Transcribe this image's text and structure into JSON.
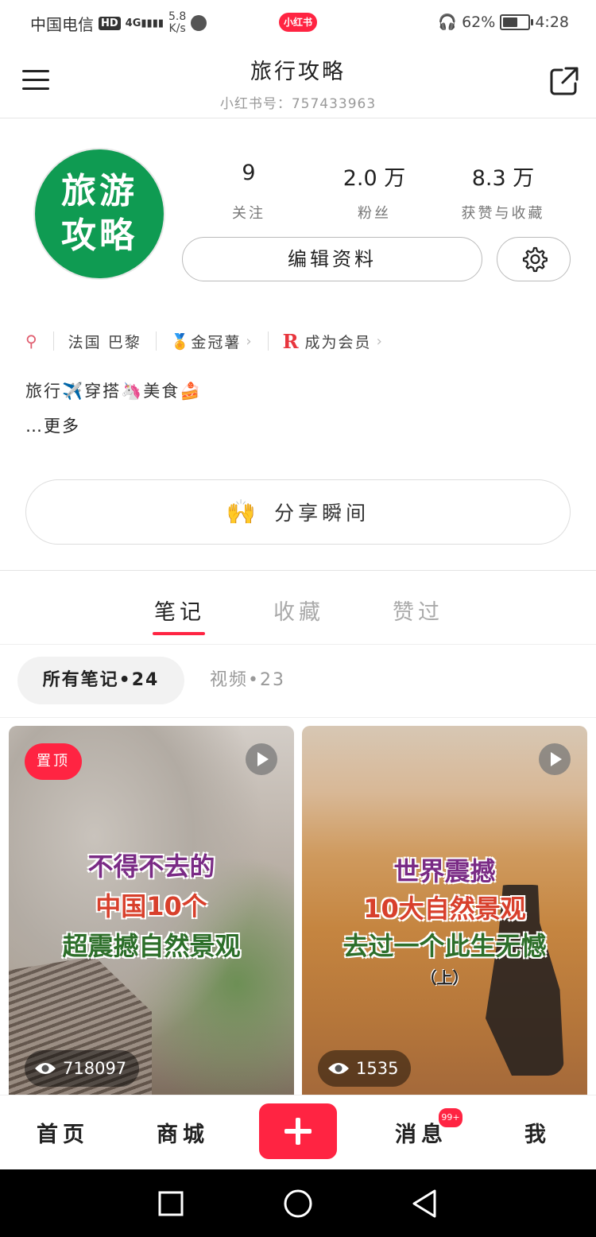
{
  "status_bar": {
    "carrier": "中国电信",
    "hd": "HD",
    "signal": "4G",
    "speed_value": "5.8",
    "speed_unit": "K/s",
    "app_pill": "小红书",
    "battery": "62%",
    "battery_level": 0.62,
    "time": "4:28"
  },
  "header": {
    "title": "旅行攻略",
    "account_id": "小红书号：757433963"
  },
  "profile": {
    "avatar_line1": "旅游",
    "avatar_line2": "攻略",
    "avatar_color": "#0f9b52",
    "stats": [
      {
        "value": "9",
        "label": "关注"
      },
      {
        "value": "2.0 万",
        "label": "粉丝"
      },
      {
        "value": "8.3 万",
        "label": "获赞与收藏"
      }
    ],
    "edit_button": "编辑资料",
    "tags": {
      "location": "法国 巴黎",
      "crown": "金冠薯",
      "member": "成为会员"
    },
    "bio": "旅行✈️穿搭🦄美食🍰",
    "more": "…更多"
  },
  "moment_button": {
    "emoji": "🙌",
    "label": "分享瞬间"
  },
  "tabs": [
    {
      "label": "笔记",
      "active": true
    },
    {
      "label": "收藏",
      "active": false
    },
    {
      "label": "赞过",
      "active": false
    }
  ],
  "filters": {
    "all_notes": "所有笔记•24",
    "videos": "视频•23"
  },
  "notes": [
    {
      "pinned_label": "置顶",
      "title_lines": [
        "不得不去的",
        "中国10个",
        "超震撼自然景观"
      ],
      "views": "718097"
    },
    {
      "title_lines": [
        "世界震撼",
        "10大自然景观",
        "去过一个此生无憾",
        "（上）"
      ],
      "views": "1535"
    }
  ],
  "bottom_nav": {
    "home": "首页",
    "mall": "商城",
    "messages": "消息",
    "messages_badge": "99+",
    "me": "我"
  },
  "colors": {
    "accent": "#ff2442"
  }
}
